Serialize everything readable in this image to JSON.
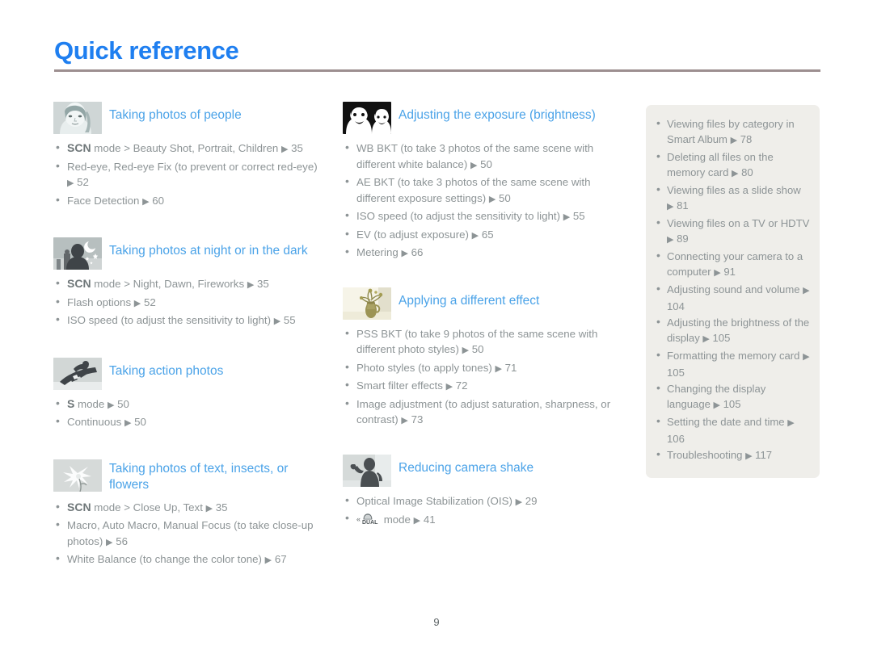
{
  "document": {
    "title": "Quick reference",
    "page_number": "9",
    "accent_color": "#1f7ff0",
    "section_title_color": "#4ba3e8",
    "body_text_color": "#8d9496",
    "rule_color": "#9d8f90",
    "panel_background": "#efeeea"
  },
  "columns": [
    {
      "sections": [
        {
          "icon": "woman-face-thumbnail",
          "title": "Taking photos of people",
          "items": [
            {
              "bold": "SCN",
              "text": " mode > Beauty Shot, Portrait, Children ",
              "arrow": "▶",
              "page": " 35"
            },
            {
              "bold": "",
              "text": "Red-eye, Red-eye Fix (to prevent or correct red-eye) ",
              "arrow": "▶",
              "page": " 52"
            },
            {
              "bold": "",
              "text": "Face Detection ",
              "arrow": "▶",
              "page": " 60"
            }
          ]
        },
        {
          "icon": "night-silhouette-thumbnail",
          "title": "Taking photos at night or in the dark",
          "items": [
            {
              "bold": "SCN",
              "text": " mode > Night, Dawn, Fireworks ",
              "arrow": "▶",
              "page": " 35"
            },
            {
              "bold": "",
              "text": "Flash options ",
              "arrow": "▶",
              "page": " 52"
            },
            {
              "bold": "",
              "text": "ISO speed (to adjust the sensitivity to light) ",
              "arrow": "▶",
              "page": " 55"
            }
          ]
        },
        {
          "icon": "snowboarder-thumbnail",
          "title": "Taking action photos",
          "items": [
            {
              "bold": "S",
              "text": " mode ",
              "arrow": "▶",
              "page": " 50"
            },
            {
              "bold": "",
              "text": "Continuous ",
              "arrow": "▶",
              "page": " 50"
            }
          ]
        },
        {
          "icon": "flower-thumbnail",
          "title": "Taking photos of text, insects, or flowers",
          "items": [
            {
              "bold": "SCN",
              "text": " mode > Close Up, Text ",
              "arrow": "▶",
              "page": " 35"
            },
            {
              "bold": "",
              "text": "Macro, Auto Macro, Manual Focus (to take close-up photos) ",
              "arrow": "▶",
              "page": " 56"
            },
            {
              "bold": "",
              "text": "White Balance (to change the color tone) ",
              "arrow": "▶",
              "page": " 67"
            }
          ]
        }
      ]
    },
    {
      "sections": [
        {
          "icon": "two-faces-highcontrast-thumbnail",
          "title": "Adjusting the exposure (brightness)",
          "items": [
            {
              "bold": "",
              "text": "WB BKT (to take 3 photos of the same scene with different white balance) ",
              "arrow": "▶",
              "page": " 50"
            },
            {
              "bold": "",
              "text": "AE BKT (to take 3 photos of the same scene with different exposure settings) ",
              "arrow": "▶",
              "page": " 50"
            },
            {
              "bold": "",
              "text": "ISO speed (to adjust the sensitivity to light) ",
              "arrow": "▶",
              "page": " 55"
            },
            {
              "bold": "",
              "text": "EV (to adjust exposure) ",
              "arrow": "▶",
              "page": " 65"
            },
            {
              "bold": "",
              "text": "Metering ",
              "arrow": "▶",
              "page": " 66"
            }
          ]
        },
        {
          "icon": "flower-vase-sepia-thumbnail",
          "title": "Applying a different effect",
          "items": [
            {
              "bold": "",
              "text": "PSS BKT (to take 9 photos of the same scene with different photo styles) ",
              "arrow": "▶",
              "page": " 50"
            },
            {
              "bold": "",
              "text": "Photo styles (to apply tones) ",
              "arrow": "▶",
              "page": " 71"
            },
            {
              "bold": "",
              "text": "Smart filter effects ",
              "arrow": "▶",
              "page": " 72"
            },
            {
              "bold": "",
              "text": "Image adjustment (to adjust saturation, sharpness, or contrast) ",
              "arrow": "▶",
              "page": " 73"
            }
          ]
        },
        {
          "icon": "waving-person-thumbnail",
          "title": "Reducing camera shake",
          "items": [
            {
              "bold": "",
              "text": "Optical Image Stabilization (OIS) ",
              "arrow": "▶",
              "page": " 29"
            },
            {
              "bold": "",
              "icon": "dual-is-icon",
              "text": " mode ",
              "arrow": "▶",
              "page": " 41"
            }
          ]
        }
      ]
    }
  ],
  "side_panel": {
    "items": [
      {
        "text": "Viewing files by category in Smart Album ",
        "arrow": "▶",
        "page": " 78"
      },
      {
        "text": "Deleting all files on the memory card ",
        "arrow": "▶",
        "page": " 80"
      },
      {
        "text": "Viewing files as a slide show ",
        "arrow": "▶",
        "page": " 81"
      },
      {
        "text": "Viewing files on a TV or HDTV ",
        "arrow": "▶",
        "page": " 89"
      },
      {
        "text": "Connecting your camera to a computer ",
        "arrow": "▶",
        "page": " 91"
      },
      {
        "text": "Adjusting sound and volume ",
        "arrow": "▶",
        "page": " 104"
      },
      {
        "text": "Adjusting the brightness of the display ",
        "arrow": "▶",
        "page": " 105"
      },
      {
        "text": "Formatting the memory card ",
        "arrow": "▶",
        "page": " 105"
      },
      {
        "text": "Changing the display language ",
        "arrow": "▶",
        "page": " 105"
      },
      {
        "text": "Setting the date and time ",
        "arrow": "▶",
        "page": " 106"
      },
      {
        "text": "Troubleshooting ",
        "arrow": "▶",
        "page": " 117"
      }
    ]
  }
}
